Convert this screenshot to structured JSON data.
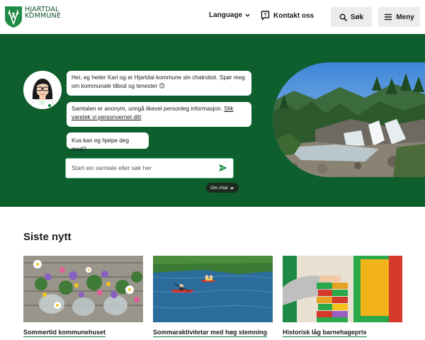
{
  "header": {
    "logo_line1": "HJARTDAL",
    "logo_line2": "KOMMUNE",
    "language_label": "Language",
    "contact_label": "Kontakt oss",
    "search_label": "Søk",
    "menu_label": "Meny"
  },
  "hero": {
    "messages": [
      "Hei, eg heiter Kari og er Hjartdal kommune sin chatrobot. Spør meg om kommunale tilbod og tenester 😊",
      "Samtalen er anonym, unngå likevel personleg informasjon.",
      "Slik varetek vi personvernet ditt",
      "Kva kan eg hjelpe deg med?"
    ],
    "input_placeholder": "Start ein samtale eller søk her",
    "about_chat_label": "Om chat"
  },
  "news": {
    "title": "Siste nytt",
    "items": [
      {
        "label": "Sommertid kommunehuset"
      },
      {
        "label": "Sommaraktivitetar med høg stemning"
      },
      {
        "label": "Historisk låg barnehagepris"
      }
    ]
  },
  "colors": {
    "brand_green": "#0e5e2e",
    "accent_green": "#0e7a3b",
    "button_grey": "#ececec"
  }
}
